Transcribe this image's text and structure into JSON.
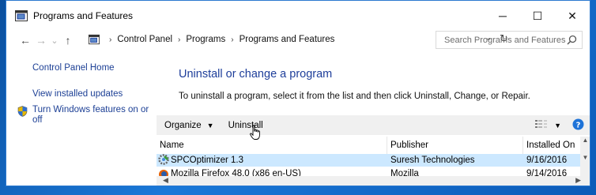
{
  "window": {
    "title": "Programs and Features",
    "minimize": "─",
    "maximize": "☐",
    "close": "✕"
  },
  "nav": {
    "back": "←",
    "forward": "→",
    "recent": "⌄",
    "up": "↑"
  },
  "breadcrumb": {
    "items": [
      "Control Panel",
      "Programs",
      "Programs and Features"
    ],
    "separator": "›",
    "dropdown": "⌄",
    "refresh": "↻"
  },
  "search": {
    "placeholder": "Search Programs and Features"
  },
  "sidebar": {
    "home": "Control Panel Home",
    "updates": "View installed updates",
    "features": "Turn Windows features on or off"
  },
  "main": {
    "heading": "Uninstall or change a program",
    "description": "To uninstall a program, select it from the list and then click Uninstall, Change, or Repair."
  },
  "toolbar": {
    "organize": "Organize",
    "organize_caret": "▼",
    "uninstall": "Uninstall",
    "view_caret": "▼"
  },
  "table": {
    "columns": [
      "Name",
      "Publisher",
      "Installed On"
    ],
    "rows": [
      {
        "name": "SPCOptimizer 1.3",
        "publisher": "Suresh Technologies",
        "installed": "9/16/2016",
        "selected": true
      },
      {
        "name": "Mozilla Firefox 48.0 (x86 en-US)",
        "publisher": "Mozilla",
        "installed": "9/14/2016",
        "selected": false
      }
    ]
  },
  "icons": {
    "app": "control-panel-icon",
    "search": "magnifier-icon",
    "shield": "uac-shield-icon",
    "help": "help-icon",
    "cursor": "hand-pointer-icon"
  },
  "colors": {
    "link": "#1c3f95",
    "heading": "#1e3e9a",
    "selection": "#cce8ff",
    "help": "#1e73d8"
  }
}
